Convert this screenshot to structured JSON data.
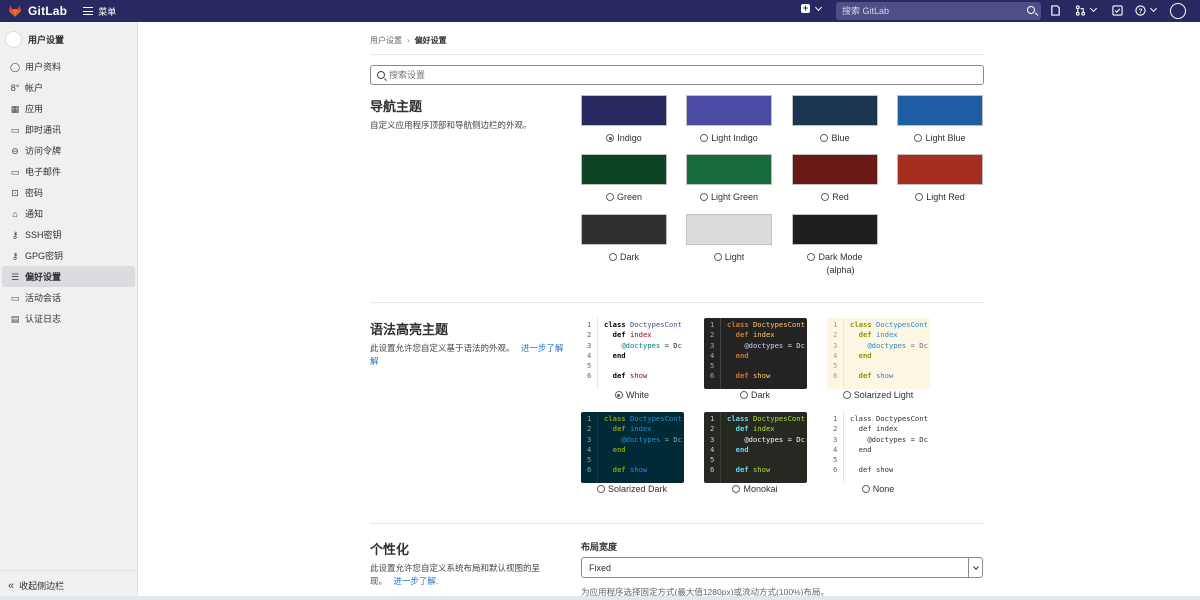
{
  "topbar": {
    "brand": "GitLab",
    "menu_label": "菜单",
    "search_placeholder": "搜索 GitLab"
  },
  "sidebar": {
    "title": "用户设置",
    "items": [
      {
        "label": "用户资料",
        "icon": "profile-icon"
      },
      {
        "label": "帐户",
        "icon": "account-icon"
      },
      {
        "label": "应用",
        "icon": "applications-icon"
      },
      {
        "label": "即时通讯",
        "icon": "chat-icon"
      },
      {
        "label": "访问令牌",
        "icon": "token-icon"
      },
      {
        "label": "电子邮件",
        "icon": "email-icon"
      },
      {
        "label": "密码",
        "icon": "lock-icon"
      },
      {
        "label": "通知",
        "icon": "bell-icon"
      },
      {
        "label": "SSH密钥",
        "icon": "key-icon"
      },
      {
        "label": "GPG密钥",
        "icon": "key-icon"
      },
      {
        "label": "偏好设置",
        "icon": "preferences-icon"
      },
      {
        "label": "活动会话",
        "icon": "monitor-icon"
      },
      {
        "label": "认证日志",
        "icon": "log-icon"
      }
    ],
    "active_index": 10,
    "collapse_label": "收起侧边栏"
  },
  "breadcrumb": {
    "parent": "用户设置",
    "current": "偏好设置"
  },
  "settings_search_placeholder": "搜索设置",
  "nav_theme": {
    "title": "导航主题",
    "description": "自定义应用程序顶部和导航侧边栏的外观。",
    "options": [
      {
        "label": "Indigo",
        "color": "#292961",
        "checked": true
      },
      {
        "label": "Light Indigo",
        "color": "#4b4ba3",
        "checked": false
      },
      {
        "label": "Blue",
        "color": "#1a3652",
        "checked": false
      },
      {
        "label": "Light Blue",
        "color": "#1f5ea6",
        "checked": false
      },
      {
        "label": "Green",
        "color": "#0d4524",
        "checked": false
      },
      {
        "label": "Light Green",
        "color": "#156b39",
        "checked": false
      },
      {
        "label": "Red",
        "color": "#691a16",
        "checked": false
      },
      {
        "label": "Light Red",
        "color": "#a62e21",
        "checked": false
      },
      {
        "label": "Dark",
        "color": "#303030",
        "checked": false
      },
      {
        "label": "Light",
        "color": "#dbdbdb",
        "checked": false
      },
      {
        "label": "Dark Mode",
        "sublabel": "(alpha)",
        "color": "#1f1f1f",
        "checked": false
      }
    ]
  },
  "syntax_theme": {
    "title": "语法高亮主题",
    "description": "此设置允许您自定义基于语法的外观。",
    "link": "进一步了解",
    "link_tail": "解",
    "code_lines": [
      "class DoctypesCont",
      "  def index",
      "    @doctypes = Dc",
      "  end",
      "",
      "  def show"
    ],
    "line_numbers": [
      "1",
      "2",
      "3",
      "4",
      "5",
      "6"
    ],
    "options": [
      {
        "label": "White",
        "checked": true,
        "bg": "#ffffff",
        "gutter": "#ffffff",
        "text": "#303030",
        "num": "#666666",
        "kw": "#000000",
        "cls": "#445588",
        "fn": "#990000",
        "iv": "#008080",
        "sep": "#e5e5e5"
      },
      {
        "label": "Dark",
        "checked": false,
        "bg": "#232323",
        "gutter": "#232323",
        "text": "#dddddd",
        "num": "#aaaaaa",
        "kw": "#cc7833",
        "cls": "#ffc66d",
        "fn": "#ffc66d",
        "iv": "#d0d0ff",
        "sep": "#444444"
      },
      {
        "label": "Solarized Light",
        "checked": false,
        "bg": "#fdf6e3",
        "gutter": "#fdf6e3",
        "text": "#657b83",
        "num": "#93a1a1",
        "kw": "#859900",
        "cls": "#268bd2",
        "fn": "#268bd2",
        "iv": "#268bd2",
        "sep": "#eee8d5"
      },
      {
        "label": "Solarized Dark",
        "checked": false,
        "bg": "#002b36",
        "gutter": "#002b36",
        "text": "#93a1a1",
        "num": "#93a1a1",
        "kw": "#859900",
        "cls": "#268bd2",
        "fn": "#268bd2",
        "iv": "#268bd2",
        "sep": "#0a3a45"
      },
      {
        "label": "Monokai",
        "checked": false,
        "bg": "#272822",
        "gutter": "#272822",
        "text": "#f8f8f2",
        "num": "#cccccc",
        "kw": "#66d9ef",
        "cls": "#a6e22e",
        "fn": "#a6e22e",
        "iv": "#f8f8f2",
        "sep": "#3e3d32"
      },
      {
        "label": "None",
        "checked": false,
        "bg": "#ffffff",
        "gutter": "#ffffff",
        "text": "#303030",
        "num": "#666666",
        "kw": "#303030",
        "cls": "#303030",
        "fn": "#303030",
        "iv": "#303030",
        "sep": "#e5e5e5"
      }
    ]
  },
  "personalization": {
    "title": "个性化",
    "description_line1": "此设置允许您自定义系统布局和默认视图的呈",
    "description_line2": "现。",
    "link": "进一步了解.",
    "layout_width_label": "布局宽度",
    "layout_width_value": "Fixed",
    "layout_width_help": "为应用程序选择固定方式(最大值1280px)或流动方式(100%)布局。"
  }
}
